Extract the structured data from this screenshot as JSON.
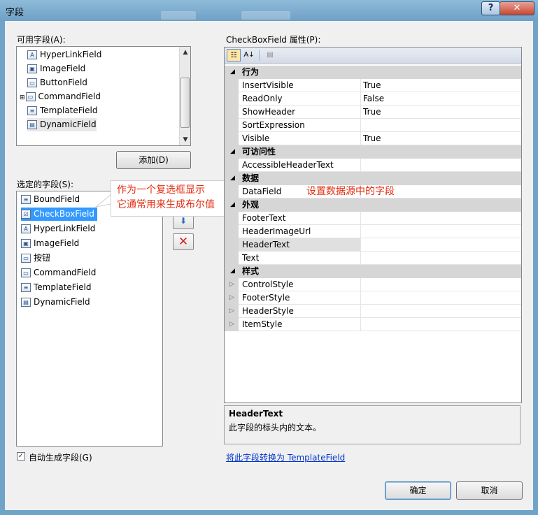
{
  "window": {
    "title": "字段"
  },
  "available_fields": {
    "label": "可用字段(A):",
    "items": [
      "HyperLinkField",
      "ImageField",
      "ButtonField",
      "CommandField",
      "TemplateField",
      "DynamicField"
    ],
    "icons": [
      "hyperlink-field-icon",
      "image-field-icon",
      "button-field-icon",
      "command-field-icon",
      "template-field-icon",
      "dynamic-field-icon"
    ],
    "add_button": "添加(D)"
  },
  "selected_fields": {
    "label": "选定的字段(S):",
    "items": [
      "BoundField",
      "CheckBoxField",
      "HyperLinkField",
      "ImageField",
      "按钮",
      "CommandField",
      "TemplateField",
      "DynamicField"
    ],
    "icons": [
      "bound-field-icon",
      "checkbox-field-icon",
      "hyperlink-field-icon",
      "image-field-icon",
      "button-field-icon",
      "command-field-icon",
      "template-field-icon",
      "dynamic-field-icon"
    ],
    "selected_index": 1
  },
  "annotations": {
    "callout_line1": "作为一个复选框显示",
    "callout_line2": "它通常用来生成布尔值",
    "datafield_note": "设置数据源中的字段"
  },
  "properties": {
    "label": "CheckBoxField 属性(P):",
    "categories": [
      {
        "name": "行为",
        "rows": [
          {
            "name": "InsertVisible",
            "value": "True"
          },
          {
            "name": "ReadOnly",
            "value": "False"
          },
          {
            "name": "ShowHeader",
            "value": "True"
          },
          {
            "name": "SortExpression",
            "value": ""
          },
          {
            "name": "Visible",
            "value": "True"
          }
        ]
      },
      {
        "name": "可访问性",
        "rows": [
          {
            "name": "AccessibleHeaderText",
            "value": ""
          }
        ]
      },
      {
        "name": "数据",
        "rows": [
          {
            "name": "DataField",
            "value": ""
          }
        ]
      },
      {
        "name": "外观",
        "rows": [
          {
            "name": "FooterText",
            "value": ""
          },
          {
            "name": "HeaderImageUrl",
            "value": ""
          },
          {
            "name": "HeaderText",
            "value": ""
          },
          {
            "name": "Text",
            "value": ""
          }
        ]
      },
      {
        "name": "样式",
        "rows": [
          {
            "name": "ControlStyle",
            "value": ""
          },
          {
            "name": "FooterStyle",
            "value": ""
          },
          {
            "name": "HeaderStyle",
            "value": ""
          },
          {
            "name": "ItemStyle",
            "value": ""
          }
        ]
      }
    ],
    "selected_property": "HeaderText"
  },
  "description": {
    "title": "HeaderText",
    "text": "此字段的标头内的文本。"
  },
  "convert_link": "将此字段转换为 TemplateField",
  "auto_generate": {
    "label": "自动生成字段(G)",
    "checked": true
  },
  "buttons": {
    "ok": "确定",
    "cancel": "取消"
  },
  "colors": {
    "selection": "#3399ff",
    "annotation_red": "#e32d12",
    "link": "#0033cc"
  }
}
